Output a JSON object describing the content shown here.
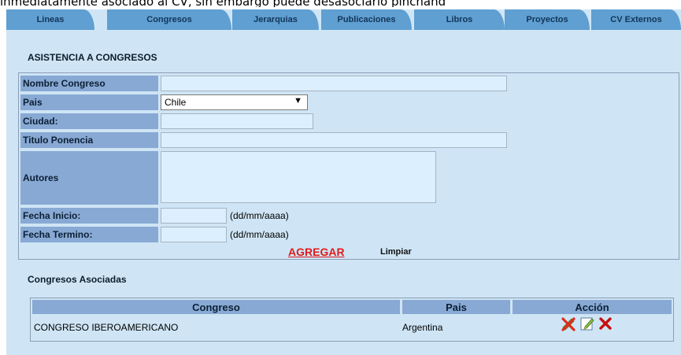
{
  "top_note": "inmediatamente asociado al CV, sin embargo puede desasociarlo pinchand",
  "tabs": [
    {
      "label": "Lineas"
    },
    {
      "label": "Congresos"
    },
    {
      "label": "Jerarquias"
    },
    {
      "label": "Publicaciones"
    },
    {
      "label": "Libros"
    },
    {
      "label": "Proyectos"
    },
    {
      "label": "CV Externos"
    }
  ],
  "section_title": "ASISTENCIA A CONGRESOS",
  "form": {
    "nombre_label": "Nombre Congreso",
    "nombre_value": "",
    "pais_label": "Pais",
    "pais_value": "Chile",
    "ciudad_label": "Ciudad:",
    "ciudad_value": "",
    "titulo_label": "Titulo Ponencia",
    "titulo_value": "",
    "autores_label": "Autores",
    "autores_value": "",
    "fecha_inicio_label": "Fecha Inicio:",
    "fecha_inicio_value": "",
    "fecha_termino_label": "Fecha Termino:",
    "fecha_termino_value": "",
    "date_format": "(dd/mm/aaaa)",
    "agregar_label": "AGREGAR",
    "limpiar_label": "Limpiar"
  },
  "associated": {
    "title": "Congresos Asociadas",
    "columns": [
      "Congreso",
      "Pais",
      "Acción"
    ],
    "rows": [
      {
        "congreso": "CONGRESO IBEROAMERICANO",
        "pais": "Argentina"
      }
    ]
  },
  "colors": {
    "tab": "#5f9fd1",
    "panel": "#cfe5f5",
    "label_bg": "#88a9d4",
    "agregar": "#e21a1a"
  },
  "icons": [
    "unlink-icon",
    "edit-icon",
    "delete-icon"
  ]
}
